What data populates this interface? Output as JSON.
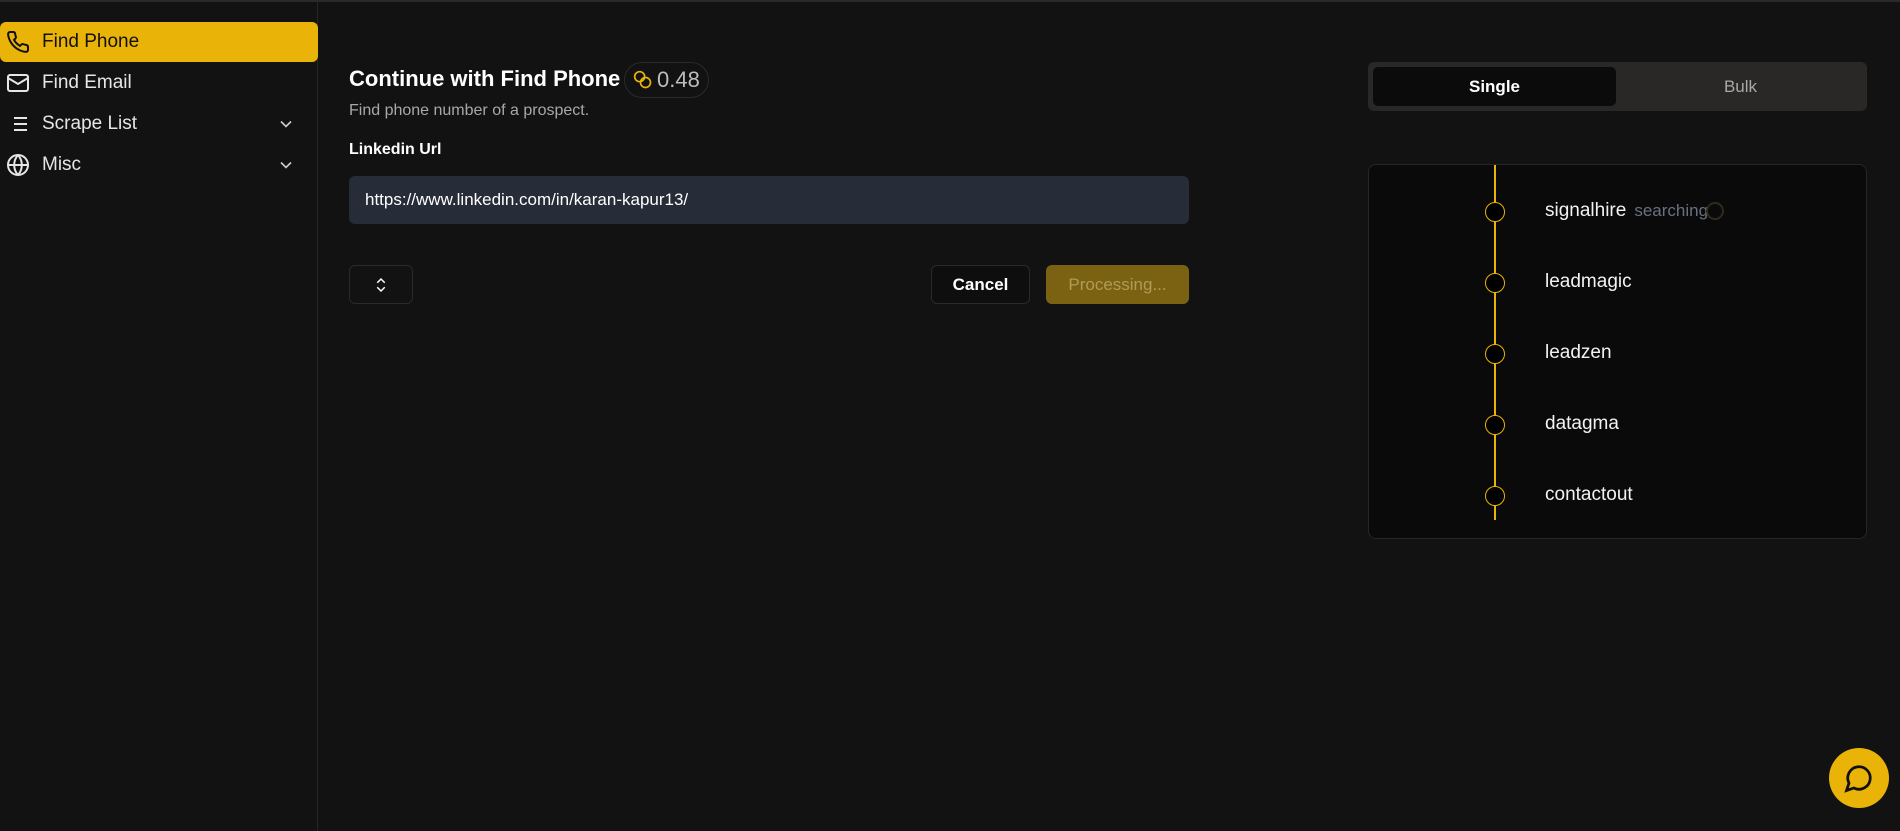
{
  "sidebar": {
    "items": [
      {
        "label": "Find Phone",
        "icon": "phone-icon",
        "active": true
      },
      {
        "label": "Find Email",
        "icon": "mail-icon"
      },
      {
        "label": "Scrape List",
        "icon": "list-icon",
        "expandable": true
      },
      {
        "label": "Misc",
        "icon": "globe-icon",
        "expandable": true
      }
    ]
  },
  "main": {
    "title": "Continue with Find Phone",
    "credits": "0.48",
    "subtitle": "Find phone number of a prospect.",
    "field_label": "Linkedin Url",
    "field_value": "https://www.linkedin.com/in/karan-kapur13/",
    "cancel_label": "Cancel",
    "submit_label": "Processing..."
  },
  "mode_toggle": {
    "options": [
      "Single",
      "Bulk"
    ],
    "selected": "Single"
  },
  "providers": [
    {
      "name": "signalhire",
      "status": "searching"
    },
    {
      "name": "leadmagic"
    },
    {
      "name": "leadzen"
    },
    {
      "name": "datagma"
    },
    {
      "name": "contactout"
    }
  ],
  "colors": {
    "accent": "#EAB308",
    "background": "#121212",
    "input": "#262c38"
  }
}
